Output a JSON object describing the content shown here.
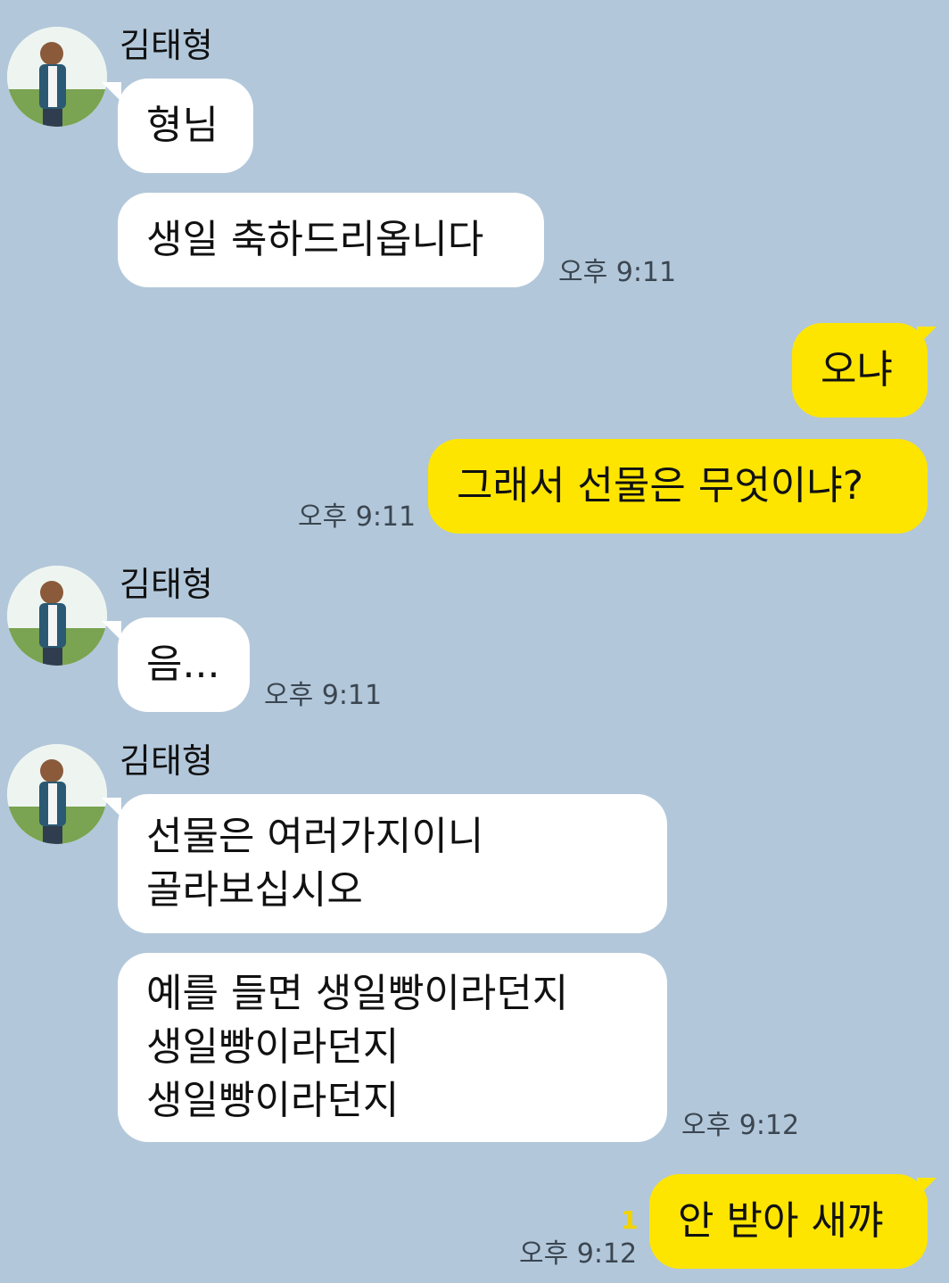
{
  "chat": {
    "groups": [
      {
        "sender": "김태형",
        "messages": [
          "형님",
          "생일 축하드리옵니다"
        ],
        "time": "오후 9:11"
      },
      {
        "me": true,
        "messages": [
          "오냐",
          "그래서 선물은 무엇이냐?"
        ],
        "time": "오후 9:11"
      },
      {
        "sender": "김태형",
        "messages": [
          "음..."
        ],
        "time": "오후 9:11"
      },
      {
        "sender": "김태형",
        "messages": [
          [
            "선물은 여러가지이니",
            "골라보십시오"
          ],
          [
            "예를 들면 생일빵이라던지",
            "생일빵이라던지",
            "생일빵이라던지"
          ]
        ],
        "time": "오후 9:12"
      },
      {
        "me": true,
        "messages": [
          "안 받아 새꺄"
        ],
        "unread": "1",
        "time": "오후 9:12"
      }
    ]
  },
  "colors": {
    "background": "#b2c7da",
    "incoming_bubble": "#ffffff",
    "outgoing_bubble": "#fee500",
    "unread_count": "#f2d300"
  },
  "icons": {
    "avatar": "profile-photo-icon"
  }
}
